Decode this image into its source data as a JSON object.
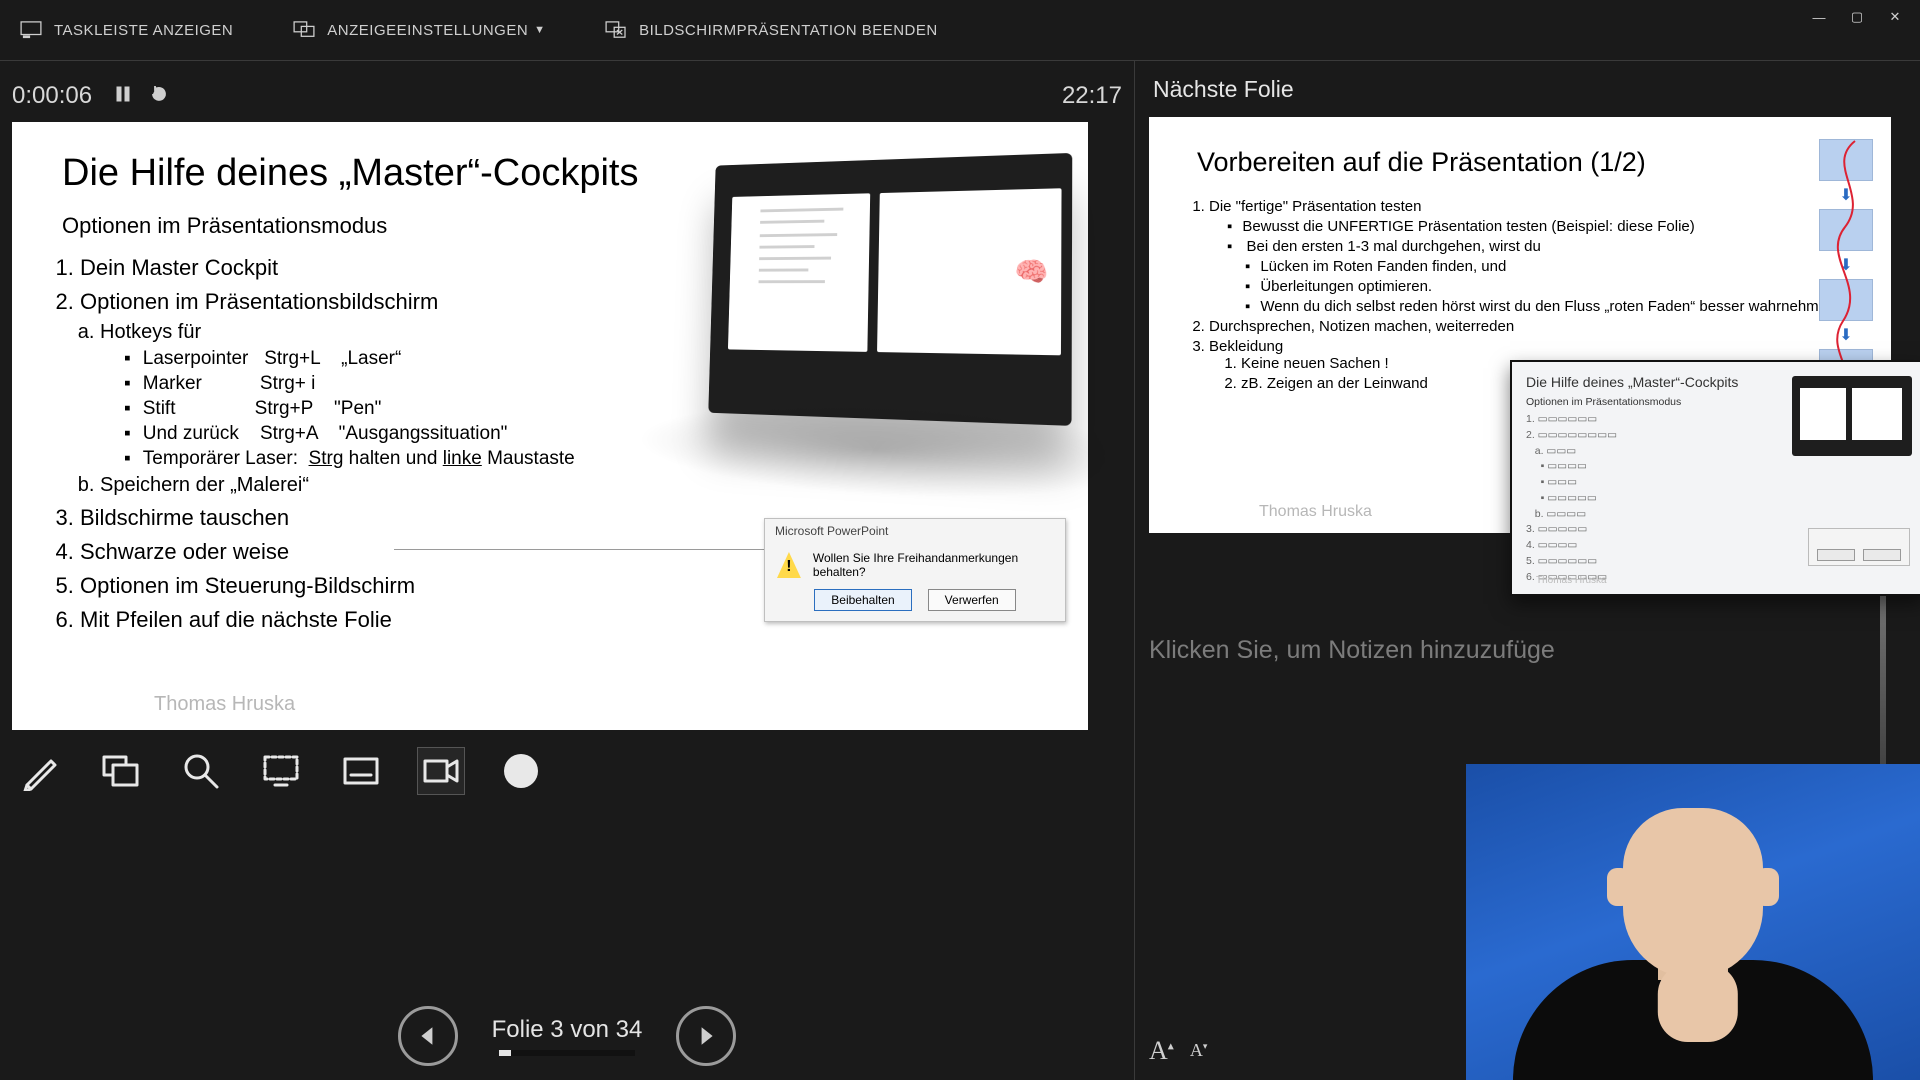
{
  "toolbar": {
    "show_taskbar": "TASKLEISTE ANZEIGEN",
    "display_settings": "ANZEIGEEINSTELLUNGEN",
    "end_show": "BILDSCHIRMPRÄSENTATION BEENDEN"
  },
  "timer": {
    "elapsed": "0:00:06",
    "clock": "22:17"
  },
  "current_slide": {
    "title": "Die Hilfe deines „Master“-Cockpits",
    "subtitle": "Optionen im Präsentationsmodus",
    "items": {
      "i1": "Dein Master Cockpit",
      "i2": "Optionen im Präsentationsbildschirm",
      "i2a": "Hotkeys für",
      "hk1": "Laserpointer   Strg+L    „Laser“",
      "hk2": "Marker           Strg+ i",
      "hk3": "Stift               Strg+P    \"Pen\"",
      "hk4": "Und zurück    Strg+A    \"Ausgangssituation\"",
      "hk5_a": "Temporärer Laser:  ",
      "hk5_b": "Strg",
      "hk5_c": " halten und ",
      "hk5_d": "linke",
      "hk5_e": " Maustaste",
      "i2b": "Speichern der „Malerei“",
      "i3": "Bildschirme tauschen",
      "i4": "Schwarze oder weise",
      "i5": "Optionen im Steuerung-Bildschirm",
      "i6": "Mit Pfeilen auf die nächste Folie"
    },
    "footer": "Thomas Hruska",
    "dialog": {
      "title": "Microsoft PowerPoint",
      "text": "Wollen Sie Ihre Freihandanmerkungen behalten?",
      "keep": "Beibehalten",
      "discard": "Verwerfen"
    }
  },
  "nav": {
    "label": "Folie 3 von 34",
    "progress_pct": 9
  },
  "right": {
    "header": "Nächste Folie",
    "next": {
      "title": "Vorbereiten auf die Präsentation (1/2)",
      "l1": "Die \"fertige\" Präsentation testen",
      "l1a": "Bewusst die UNFERTIGE Präsentation testen (Beispiel: diese Folie)",
      "l1b": "Bei den ersten 1-3 mal durchgehen, wirst du",
      "l1b1": "Lücken im Roten Fanden finden, und",
      "l1b2": "Überleitungen optimieren.",
      "l1b3": "Wenn du dich selbst reden hörst wirst du den Fluss „roten Faden“ besser wahrnehmen",
      "l2": "Durchsprechen, Notizen machen, weiterreden",
      "l3": "Bekleidung",
      "l3a": "Keine neuen Sachen !",
      "l3b": "zB. Zeigen an der Leinwand",
      "footer": "Thomas Hruska"
    },
    "notes_placeholder": "Klicken Sie, um Notizen hinzuzufüge",
    "pip": {
      "title": "Die Hilfe deines „Master“-Cockpits",
      "sub": "Optionen im Präsentationsmodus",
      "footer": "Thomas Hruska"
    }
  }
}
